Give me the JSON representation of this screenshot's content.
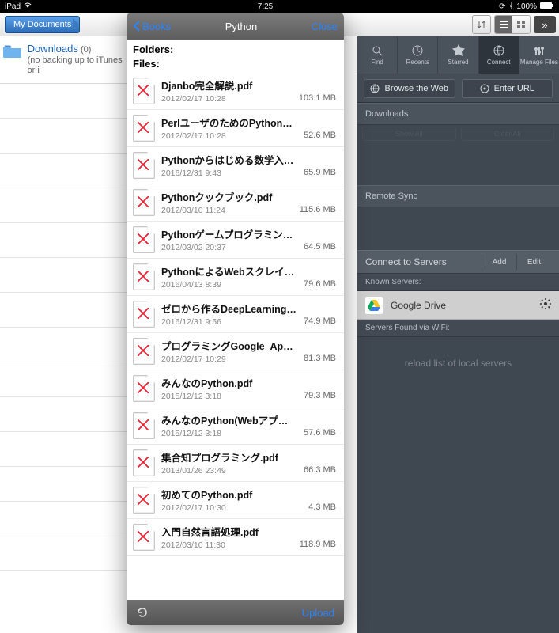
{
  "statusbar": {
    "device": "iPad",
    "time": "7:25",
    "bt": "100%"
  },
  "breadcrumb": {
    "my_documents": "My Documents"
  },
  "downloads_row": {
    "title": "Downloads",
    "count": "(0)",
    "subtitle": "(no backing up to iTunes or i"
  },
  "view_controls": {
    "sort": "sort",
    "list": "list",
    "grid": "grid",
    "expand": "»"
  },
  "modal": {
    "back": "Books",
    "title": "Python",
    "close": "Close",
    "section_folders": "Folders:",
    "section_files": "Files:",
    "upload": "Upload",
    "files": [
      {
        "name": "Djanbo完全解説.pdf",
        "date": "2012/02/17 10:28",
        "size": "103.1 MB"
      },
      {
        "name": "PerlユーザのためのPython移行ガイド.pdf",
        "date": "2012/02/17 10:28",
        "size": "52.6 MB"
      },
      {
        "name": "Pythonからはじめる数学入門.pdf",
        "date": "2016/12/31 9:43",
        "size": "65.9 MB"
      },
      {
        "name": "Pythonクックブック.pdf",
        "date": "2012/03/10 11:24",
        "size": "115.6 MB"
      },
      {
        "name": "Pythonゲームプログラミング入門.pdf",
        "date": "2012/03/02 20:37",
        "size": "64.5 MB"
      },
      {
        "name": "PythonによるWebスクレイピング.pdf",
        "date": "2016/04/13 8:39",
        "size": "79.6 MB"
      },
      {
        "name": "ゼロから作るDeepLearning.pdf",
        "date": "2016/12/31 9:56",
        "size": "74.9 MB"
      },
      {
        "name": "プログラミングGoogle_App_Engine.pdf",
        "date": "2012/02/17 10:29",
        "size": "81.3 MB"
      },
      {
        "name": "みんなのPython.pdf",
        "date": "2015/12/12 3:18",
        "size": "79.3 MB"
      },
      {
        "name": "みんなのPython(Webアプリ編).pdf",
        "date": "2015/12/12 3:18",
        "size": "57.6 MB"
      },
      {
        "name": "集合知プログラミング.pdf",
        "date": "2013/01/26 23:49",
        "size": "66.3 MB"
      },
      {
        "name": "初めてのPython.pdf",
        "date": "2012/02/17 10:30",
        "size": "4.3 MB"
      },
      {
        "name": "入門自然言語処理.pdf",
        "date": "2012/03/10 11:30",
        "size": "118.9 MB"
      }
    ]
  },
  "right_panel": {
    "tabs": {
      "find": "Find",
      "recents": "Recents",
      "starred": "Starred",
      "connect": "Connect",
      "manage": "Manage Files"
    },
    "actions": {
      "browse": "Browse the Web",
      "enter_url": "Enter URL"
    },
    "downloads_section": "Downloads",
    "show_all": "Show All",
    "clear_all": "Clear All",
    "remote_sync": "Remote Sync",
    "connect_servers": "Connect to Servers",
    "add": "Add",
    "edit": "Edit",
    "known_servers": "Known Servers:",
    "google_drive": "Google Drive",
    "wifi_section": "Servers Found via WiFi:",
    "wifi_msg": "reload list of local servers"
  }
}
